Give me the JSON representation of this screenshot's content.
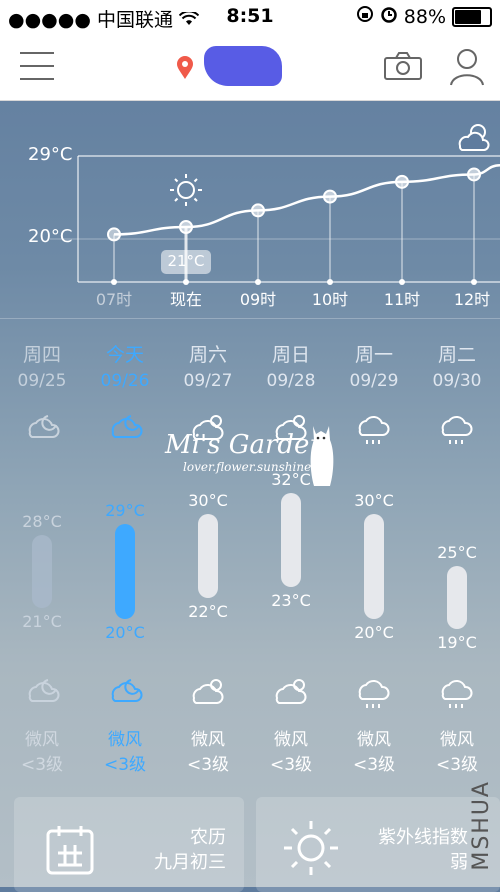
{
  "status_bar": {
    "signal": "●●●●●",
    "carrier": "中国联通",
    "time": "8:51",
    "battery": "88%",
    "battery_level": 0.88
  },
  "hourly": {
    "temp_axis": [
      "29°C",
      "20°C"
    ],
    "current_temp": "21°C",
    "hours": [
      "07时",
      "现在",
      "09时",
      "10时",
      "11时",
      "12时"
    ],
    "temps": [
      20.5,
      21.3,
      23.1,
      24.6,
      26.2,
      27.0,
      28.0
    ]
  },
  "daily": [
    {
      "name": "周四",
      "date": "09/25",
      "high": "28°C",
      "low": "21°C",
      "high_val": 28,
      "low_val": 21,
      "wind": "微风",
      "level": "<3级",
      "icon": "cloudy-night-icon",
      "state": "past"
    },
    {
      "name": "今天",
      "date": "09/26",
      "high": "29°C",
      "low": "20°C",
      "high_val": 29,
      "low_val": 20,
      "wind": "微风",
      "level": "<3级",
      "icon": "cloudy-night-icon",
      "state": "today"
    },
    {
      "name": "周六",
      "date": "09/27",
      "high": "30°C",
      "low": "22°C",
      "high_val": 30,
      "low_val": 22,
      "wind": "微风",
      "level": "<3级",
      "icon": "partly-cloudy-icon",
      "state": "future"
    },
    {
      "name": "周日",
      "date": "09/28",
      "high": "32°C",
      "low": "23°C",
      "high_val": 32,
      "low_val": 23,
      "wind": "微风",
      "level": "<3级",
      "icon": "partly-cloudy-icon",
      "state": "future"
    },
    {
      "name": "周一",
      "date": "09/29",
      "high": "30°C",
      "low": "20°C",
      "high_val": 30,
      "low_val": 20,
      "wind": "微风",
      "level": "<3级",
      "icon": "rain-icon",
      "state": "future"
    },
    {
      "name": "周二",
      "date": "09/30",
      "high": "25°C",
      "low": "19°C",
      "high_val": 25,
      "low_val": 19,
      "wind": "微风",
      "level": "<3级",
      "icon": "rain-icon",
      "state": "future"
    }
  ],
  "watermark": {
    "title": "Mi's Garden",
    "subtitle": "lover.flower.sunshine"
  },
  "cards": {
    "lunar_title": "农历",
    "lunar_value": "九月初三",
    "uv_title": "紫外线指数",
    "uv_value": "弱"
  },
  "side_mark": "MSHUA",
  "colors": {
    "accent": "#3ea9ff",
    "pin": "#f05a4a"
  }
}
